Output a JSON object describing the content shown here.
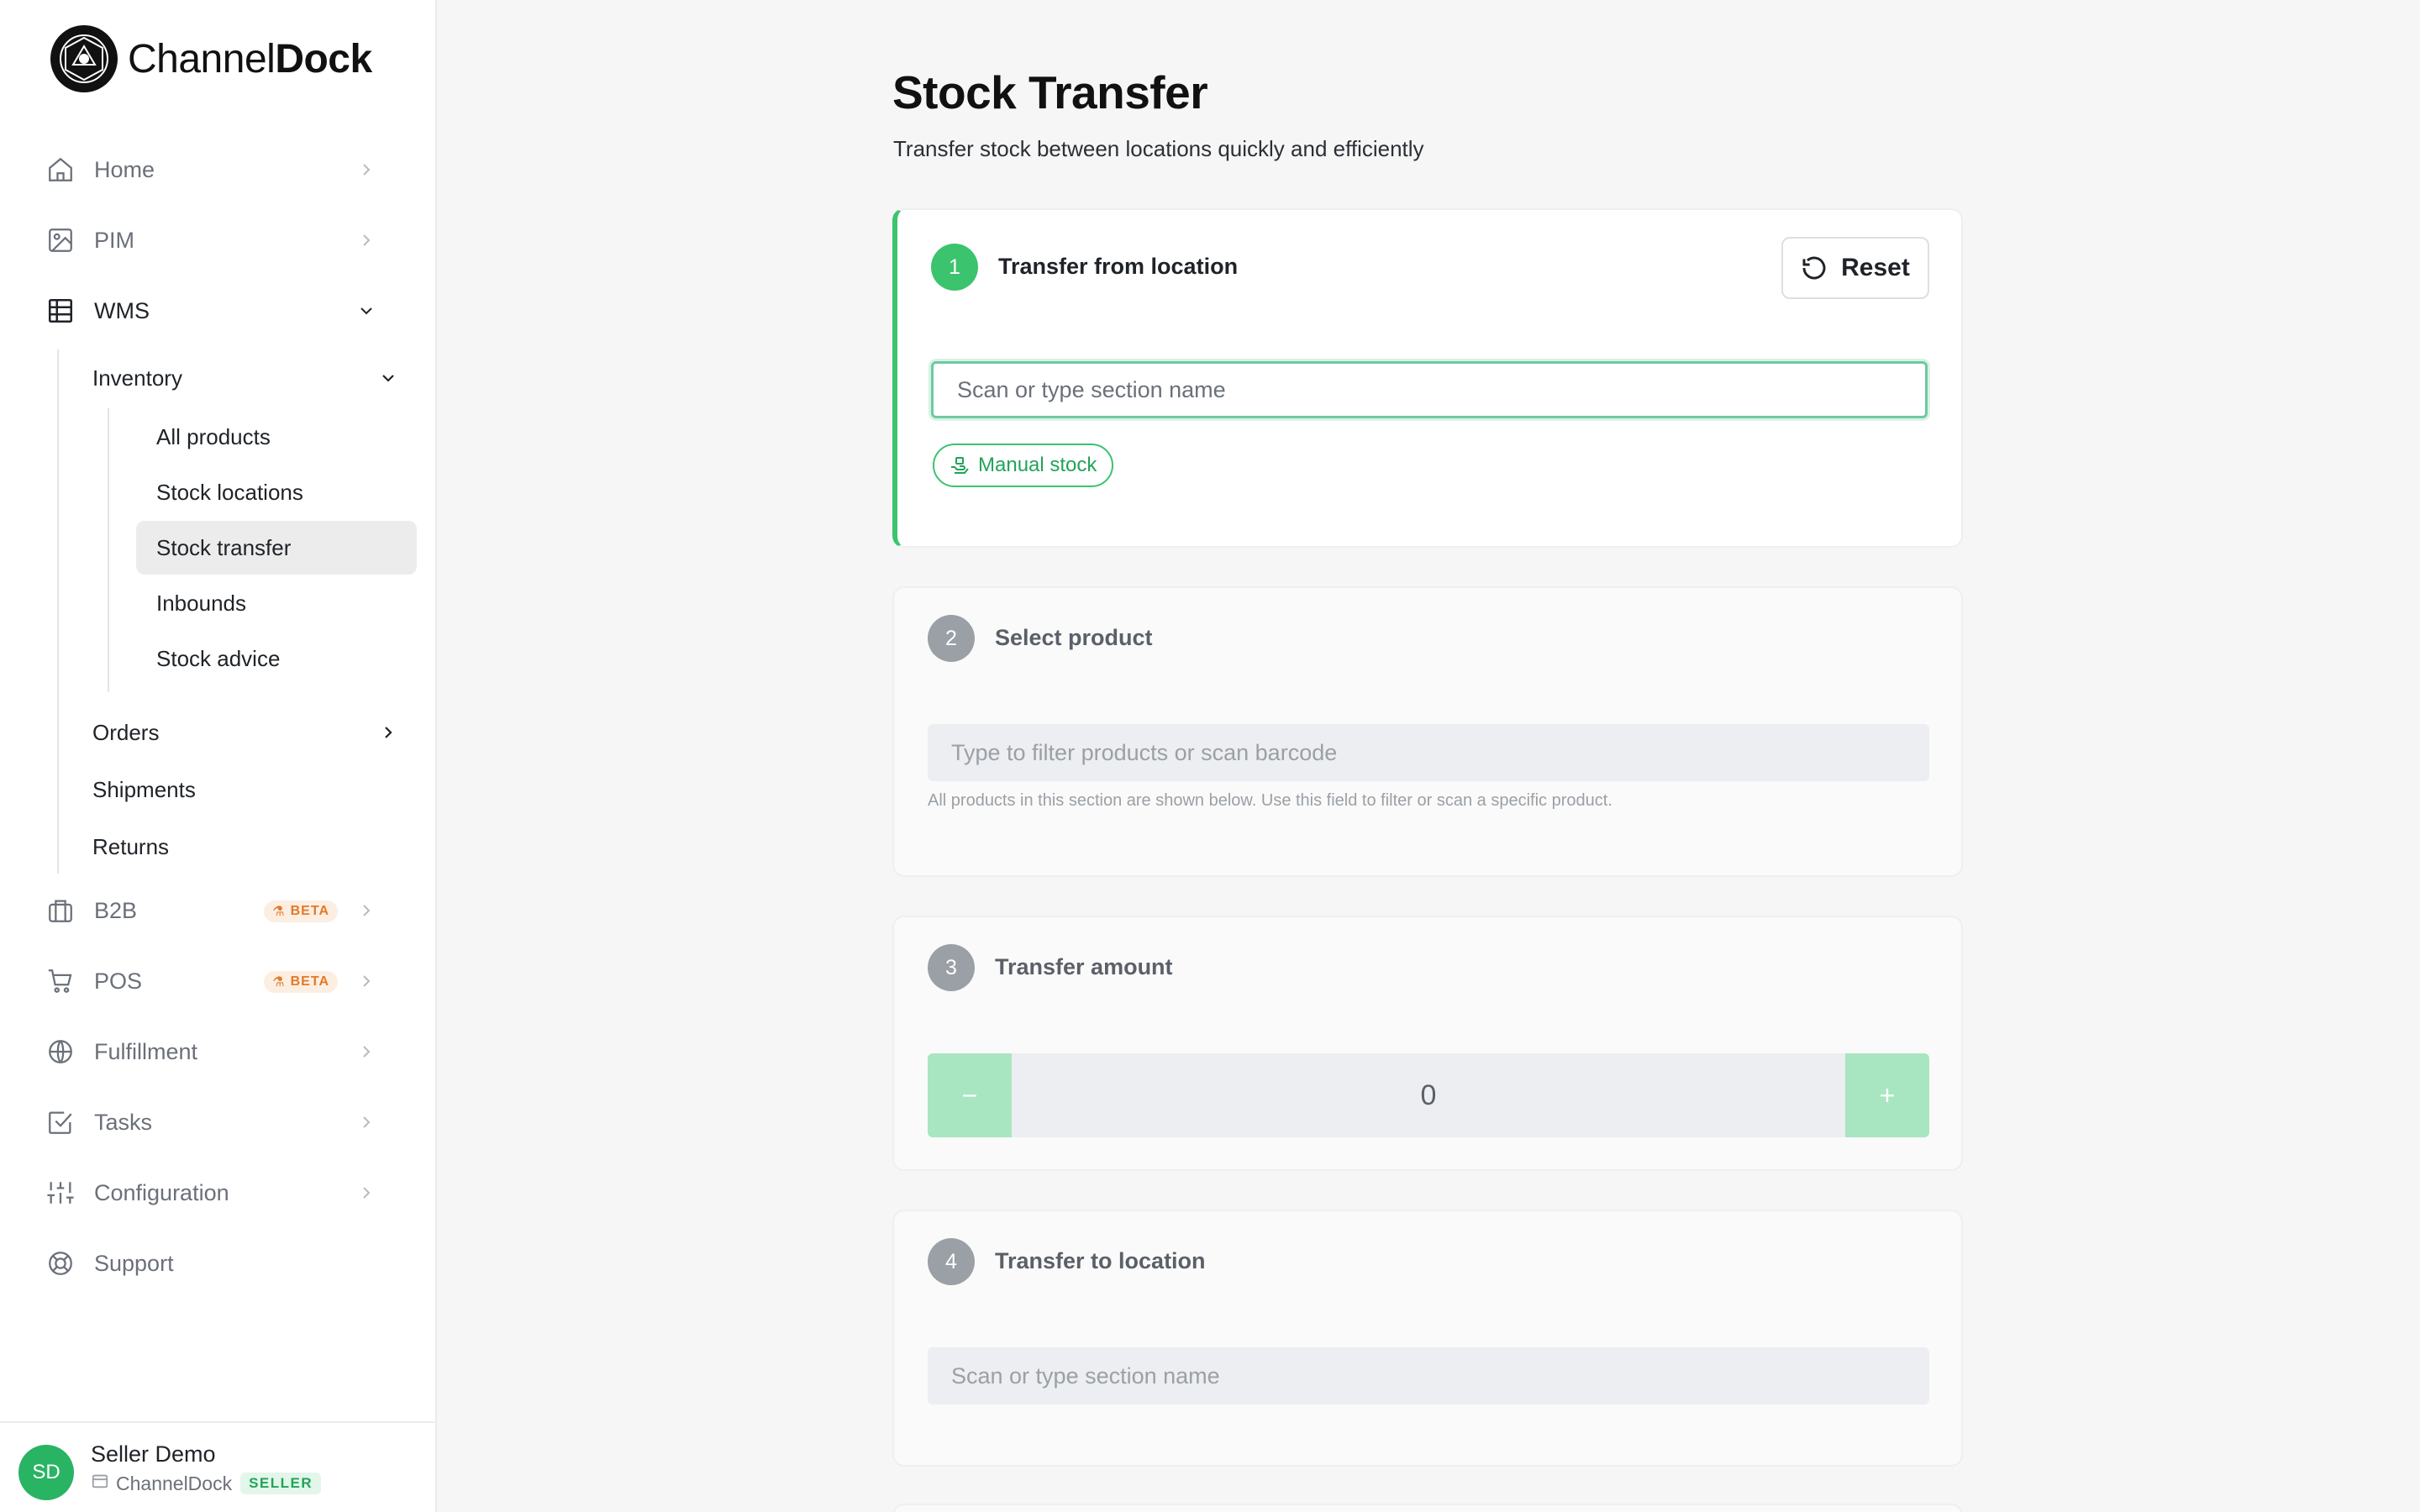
{
  "brand": {
    "name_light": "Channel",
    "name_bold": "Dock"
  },
  "sidebar": {
    "items": [
      {
        "label": "Home",
        "icon": "home-icon"
      },
      {
        "label": "PIM",
        "icon": "image-icon"
      },
      {
        "label": "WMS",
        "icon": "table-icon",
        "expanded": true
      },
      {
        "label": "B2B",
        "icon": "briefcase-icon",
        "badge": "BETA"
      },
      {
        "label": "POS",
        "icon": "cart-icon",
        "badge": "BETA"
      },
      {
        "label": "Fulfillment",
        "icon": "globe-icon"
      },
      {
        "label": "Tasks",
        "icon": "checkbox-icon"
      },
      {
        "label": "Configuration",
        "icon": "sliders-icon"
      },
      {
        "label": "Support",
        "icon": "lifebuoy-icon"
      }
    ],
    "wms": {
      "inventory_label": "Inventory",
      "inventory_items": [
        "All products",
        "Stock locations",
        "Stock transfer",
        "Inbounds",
        "Stock advice"
      ],
      "active_item": "Stock transfer",
      "orders_label": "Orders",
      "shipments_label": "Shipments",
      "returns_label": "Returns"
    }
  },
  "user": {
    "initials": "SD",
    "name": "Seller Demo",
    "company": "ChannelDock",
    "role": "SELLER"
  },
  "page": {
    "title": "Stock Transfer",
    "subtitle": "Transfer stock between locations quickly and efficiently"
  },
  "steps": [
    {
      "num": "1",
      "title": "Transfer from location",
      "placeholder": "Scan or type section name",
      "manual_label": "Manual stock",
      "reset_label": "Reset"
    },
    {
      "num": "2",
      "title": "Select product",
      "placeholder": "Type to filter products or scan barcode",
      "helper": "All products in this section are shown below. Use this field to filter or scan a specific product."
    },
    {
      "num": "3",
      "title": "Transfer amount",
      "amount": "0",
      "minus": "−",
      "plus": "+"
    },
    {
      "num": "4",
      "title": "Transfer to location",
      "placeholder": "Scan or type section name"
    }
  ],
  "colors": {
    "accent": "#3cc36e",
    "beta": "#e07a2a",
    "muted_step": "#9aa0a6"
  }
}
